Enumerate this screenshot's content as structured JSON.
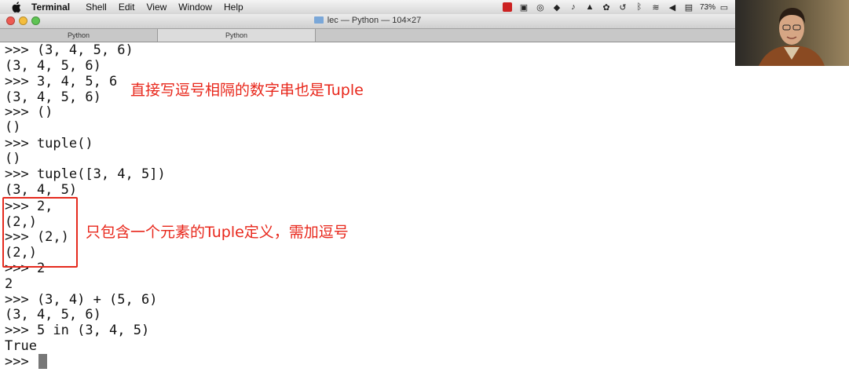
{
  "menubar": {
    "app_name": "Terminal",
    "items": [
      "Shell",
      "Edit",
      "View",
      "Window",
      "Help"
    ],
    "battery": "73%"
  },
  "window": {
    "title": "lec — Python — 104×27",
    "tabs": [
      "Python",
      "Python"
    ]
  },
  "terminal": {
    "lines": [
      ">>> (3, 4, 5, 6)",
      "(3, 4, 5, 6)",
      ">>> 3, 4, 5, 6",
      "(3, 4, 5, 6)",
      ">>> ()",
      "()",
      ">>> tuple()",
      "()",
      ">>> tuple([3, 4, 5])",
      "(3, 4, 5)",
      ">>> 2,",
      "(2,)",
      ">>> (2,)",
      "(2,)",
      ">>> 2",
      "2",
      ">>> (3, 4) + (5, 6)",
      "(3, 4, 5, 6)",
      ">>> 5 in (3, 4, 5)",
      "True",
      ">>> "
    ]
  },
  "annotations": {
    "note1": "直接写逗号相隔的数字串也是Tuple",
    "note2": "只包含一个元素的Tuple定义，需加逗号"
  },
  "colors": {
    "annotation": "#e8271b",
    "cursor": "#777777"
  }
}
